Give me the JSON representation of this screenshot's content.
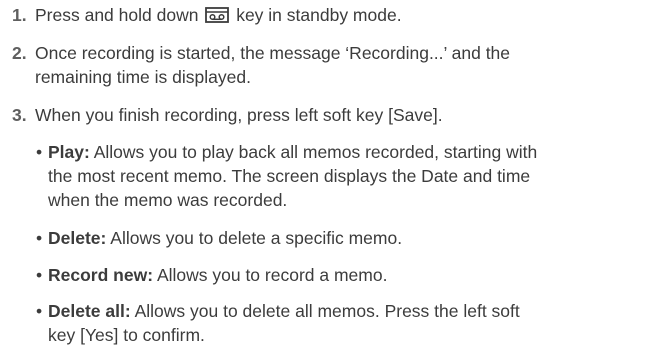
{
  "steps": [
    {
      "number": "1.",
      "text_before_icon": "Press and hold down",
      "icon": "voice-memo-key-icon",
      "text_after_icon": "key in standby mode."
    },
    {
      "number": "2.",
      "line1": "Once recording is started, the message ‘Recording...’ and the",
      "line2": "remaining time is displayed."
    },
    {
      "number": "3.",
      "line1": "When you finish recording, press left soft key [Save]."
    }
  ],
  "options": [
    {
      "bullet": "•",
      "term": "Play:",
      "line1": "Allows you to play back all memos recorded, starting with",
      "line2": "the most recent memo. The screen displays the Date and time",
      "line3": "when the memo was recorded."
    },
    {
      "bullet": "•",
      "term": "Delete:",
      "line1": "Allows you to delete a specific memo."
    },
    {
      "bullet": "•",
      "term": "Record new:",
      "line1": "Allows you to record a memo."
    },
    {
      "bullet": "•",
      "term": "Delete all:",
      "line1": "Allows you to delete all memos. Press the left soft",
      "line2": "key [Yes] to confirm."
    }
  ]
}
